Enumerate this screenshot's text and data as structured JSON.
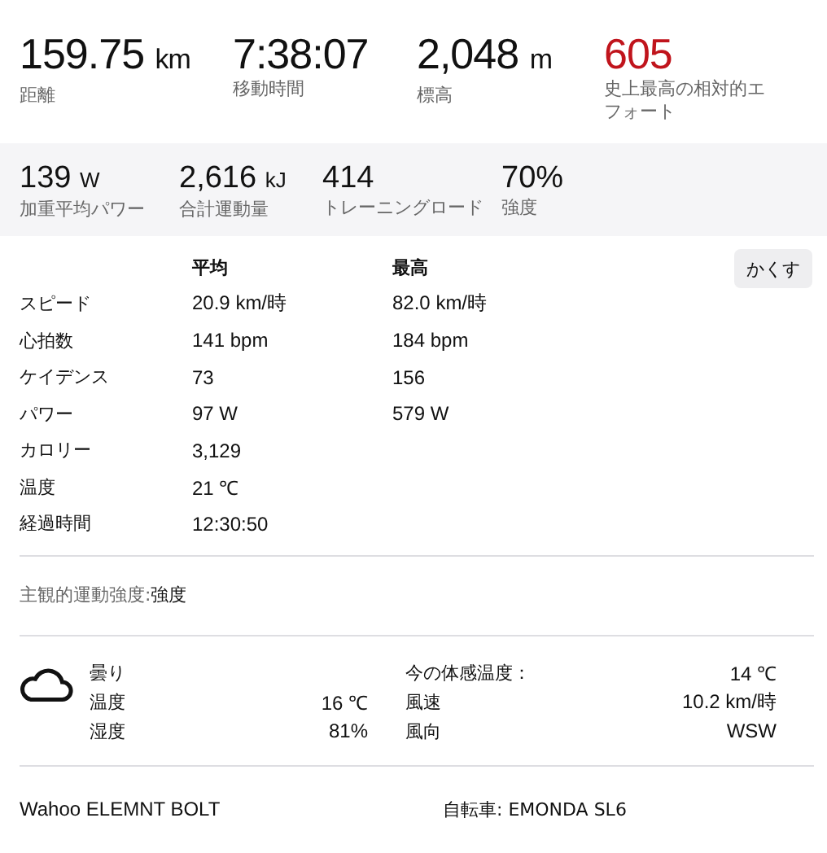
{
  "primary_stats": [
    {
      "value": "159.75",
      "unit": "km",
      "label": "距離"
    },
    {
      "value": "7:38:07",
      "label": "移動時間"
    },
    {
      "value": "2,048",
      "unit": "m",
      "label": "標高"
    },
    {
      "value": "605",
      "label": "史上最高の相対的エフォート",
      "color": "#c0141c"
    }
  ],
  "secondary_stats": [
    {
      "value": "139",
      "unit": "W",
      "label": "加重平均パワー"
    },
    {
      "value": "2,616",
      "unit": "kJ",
      "label": "合計運動量"
    },
    {
      "value": "414",
      "label": "トレーニングロード"
    },
    {
      "value": "70%",
      "label": "強度"
    }
  ],
  "table": {
    "columns": [
      "平均",
      "最高"
    ],
    "hide_button": "かくす",
    "rows": [
      {
        "label": "スピード",
        "avg": "20.9 km/時",
        "max": "82.0 km/時"
      },
      {
        "label": "心拍数",
        "avg": "141 bpm",
        "max": "184 bpm"
      },
      {
        "label": "ケイデンス",
        "avg": "73",
        "max": "156"
      },
      {
        "label": "パワー",
        "avg": "97 W",
        "max": "579 W"
      },
      {
        "label": "カロリー",
        "avg": "3,129"
      },
      {
        "label": "温度",
        "avg": "21 ℃"
      },
      {
        "label": "経過時間",
        "avg": "12:30:50"
      }
    ]
  },
  "perceived_exertion": {
    "label": "主観的運動強度:",
    "value": "強度"
  },
  "weather": {
    "condition": "曇り",
    "left": [
      {
        "label": "温度",
        "value": "16 ℃"
      },
      {
        "label": "湿度",
        "value": "81%"
      }
    ],
    "right": [
      {
        "label": "今の体感温度：",
        "value": "14 ℃"
      },
      {
        "label": "風速",
        "value": "10.2 km/時"
      },
      {
        "label": "風向",
        "value": "WSW"
      }
    ]
  },
  "footer": {
    "device": "Wahoo ELEMNT BOLT",
    "bike": "自転車: EMONDA SL6"
  }
}
